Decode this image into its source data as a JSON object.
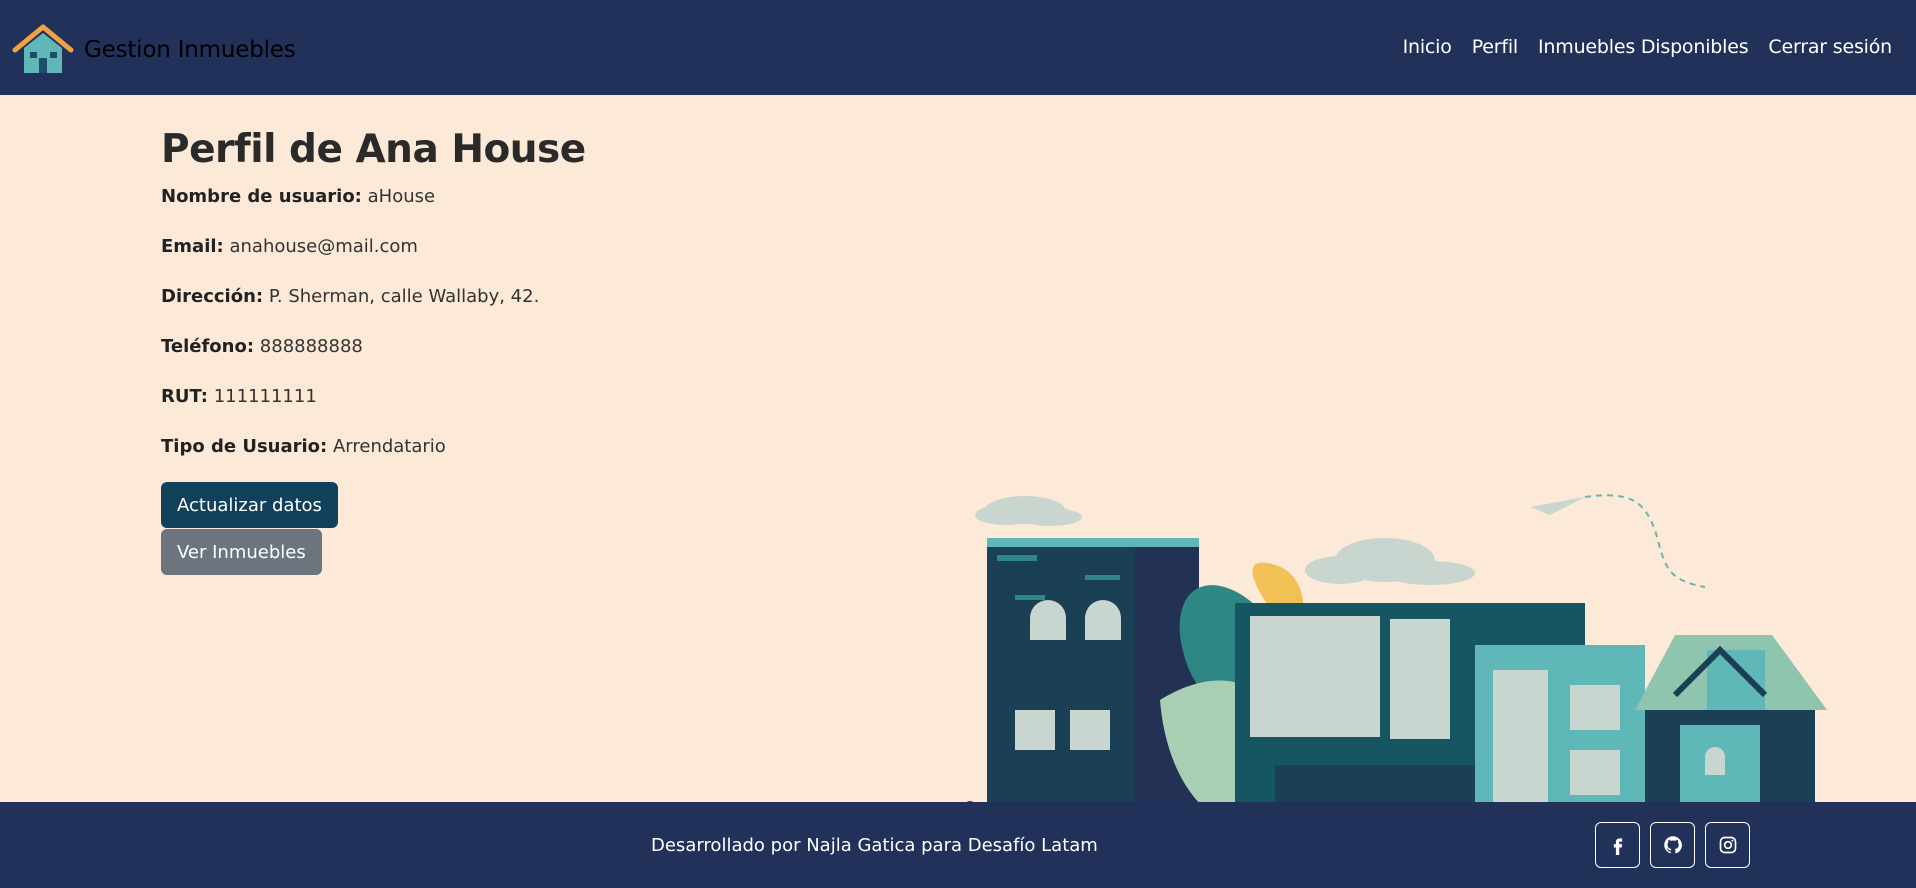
{
  "navbar": {
    "brand": "Gestion Inmuebles",
    "links": [
      "Inicio",
      "Perfil",
      "Inmuebles Disponibles",
      "Cerrar sesión"
    ]
  },
  "profile": {
    "title": "Perfil de Ana House",
    "fields": [
      {
        "label": "Nombre de usuario:",
        "value": "aHouse"
      },
      {
        "label": "Email:",
        "value": "anahouse@mail.com"
      },
      {
        "label": "Dirección:",
        "value": "P. Sherman, calle Wallaby, 42."
      },
      {
        "label": "Teléfono:",
        "value": "888888888"
      },
      {
        "label": "RUT:",
        "value": "111111111"
      },
      {
        "label": "Tipo de Usuario:",
        "value": "Arrendatario"
      }
    ],
    "update_button": "Actualizar datos",
    "view_button": "Ver Inmuebles"
  },
  "footer": {
    "text": "Desarrollado por Najla Gatica para Desafío Latam",
    "social_icons": [
      "facebook-icon",
      "github-icon",
      "instagram-icon"
    ]
  },
  "colors": {
    "navbar_bg": "#22315a",
    "page_bg": "#fde9d8",
    "primary_button": "#10405a",
    "secondary_button": "#6c757d"
  }
}
